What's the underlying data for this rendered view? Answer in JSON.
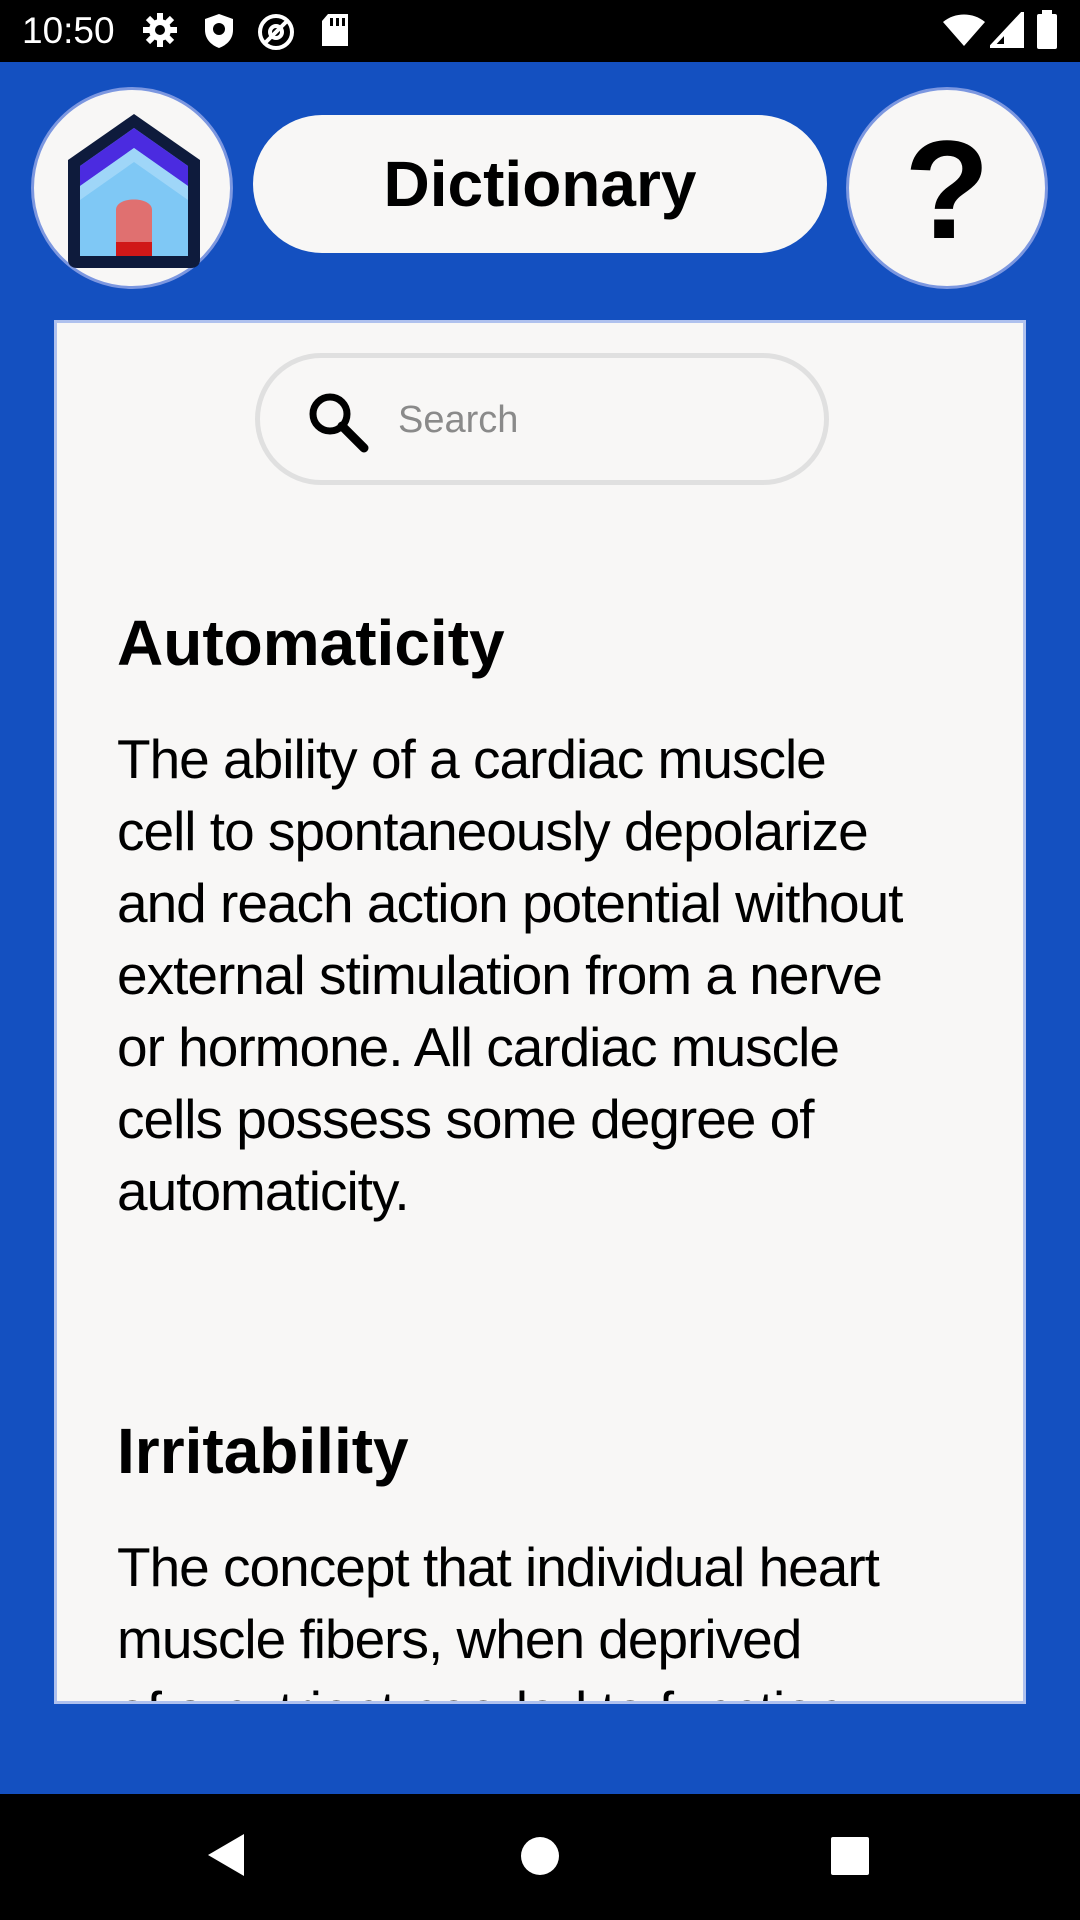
{
  "status_bar": {
    "time": "10:50",
    "left_icons": [
      "gear-icon",
      "shield-icon",
      "at-sign-icon",
      "sd-card-icon"
    ],
    "right_icons": [
      "wifi-icon",
      "signal-icon",
      "battery-icon"
    ]
  },
  "header": {
    "home_icon": "house-icon",
    "title": "Dictionary",
    "help_label": "?"
  },
  "search": {
    "placeholder": "Search",
    "value": ""
  },
  "entries": [
    {
      "term": "Automaticity",
      "definition_lines": [
        "The ability of a cardiac muscle",
        "cell to spontaneously depolarize",
        "and reach action potential without",
        "external stimulation from a nerve",
        "or hormone. All cardiac muscle",
        "cells possess some degree of",
        "automaticity."
      ]
    },
    {
      "term": "Irritability",
      "definition_lines": [
        "The concept that individual heart",
        "muscle fibers, when deprived",
        "of a nutrient needed to function"
      ]
    }
  ],
  "colors": {
    "app_background": "#1450C0",
    "panel_background": "#F8F7F6",
    "house_roof": "#4B2BE0",
    "house_body": "#7FC8F5",
    "house_door": "#E07070"
  },
  "nav_bar": {
    "buttons": [
      "back-icon",
      "home-circle-icon",
      "recents-square-icon"
    ]
  }
}
